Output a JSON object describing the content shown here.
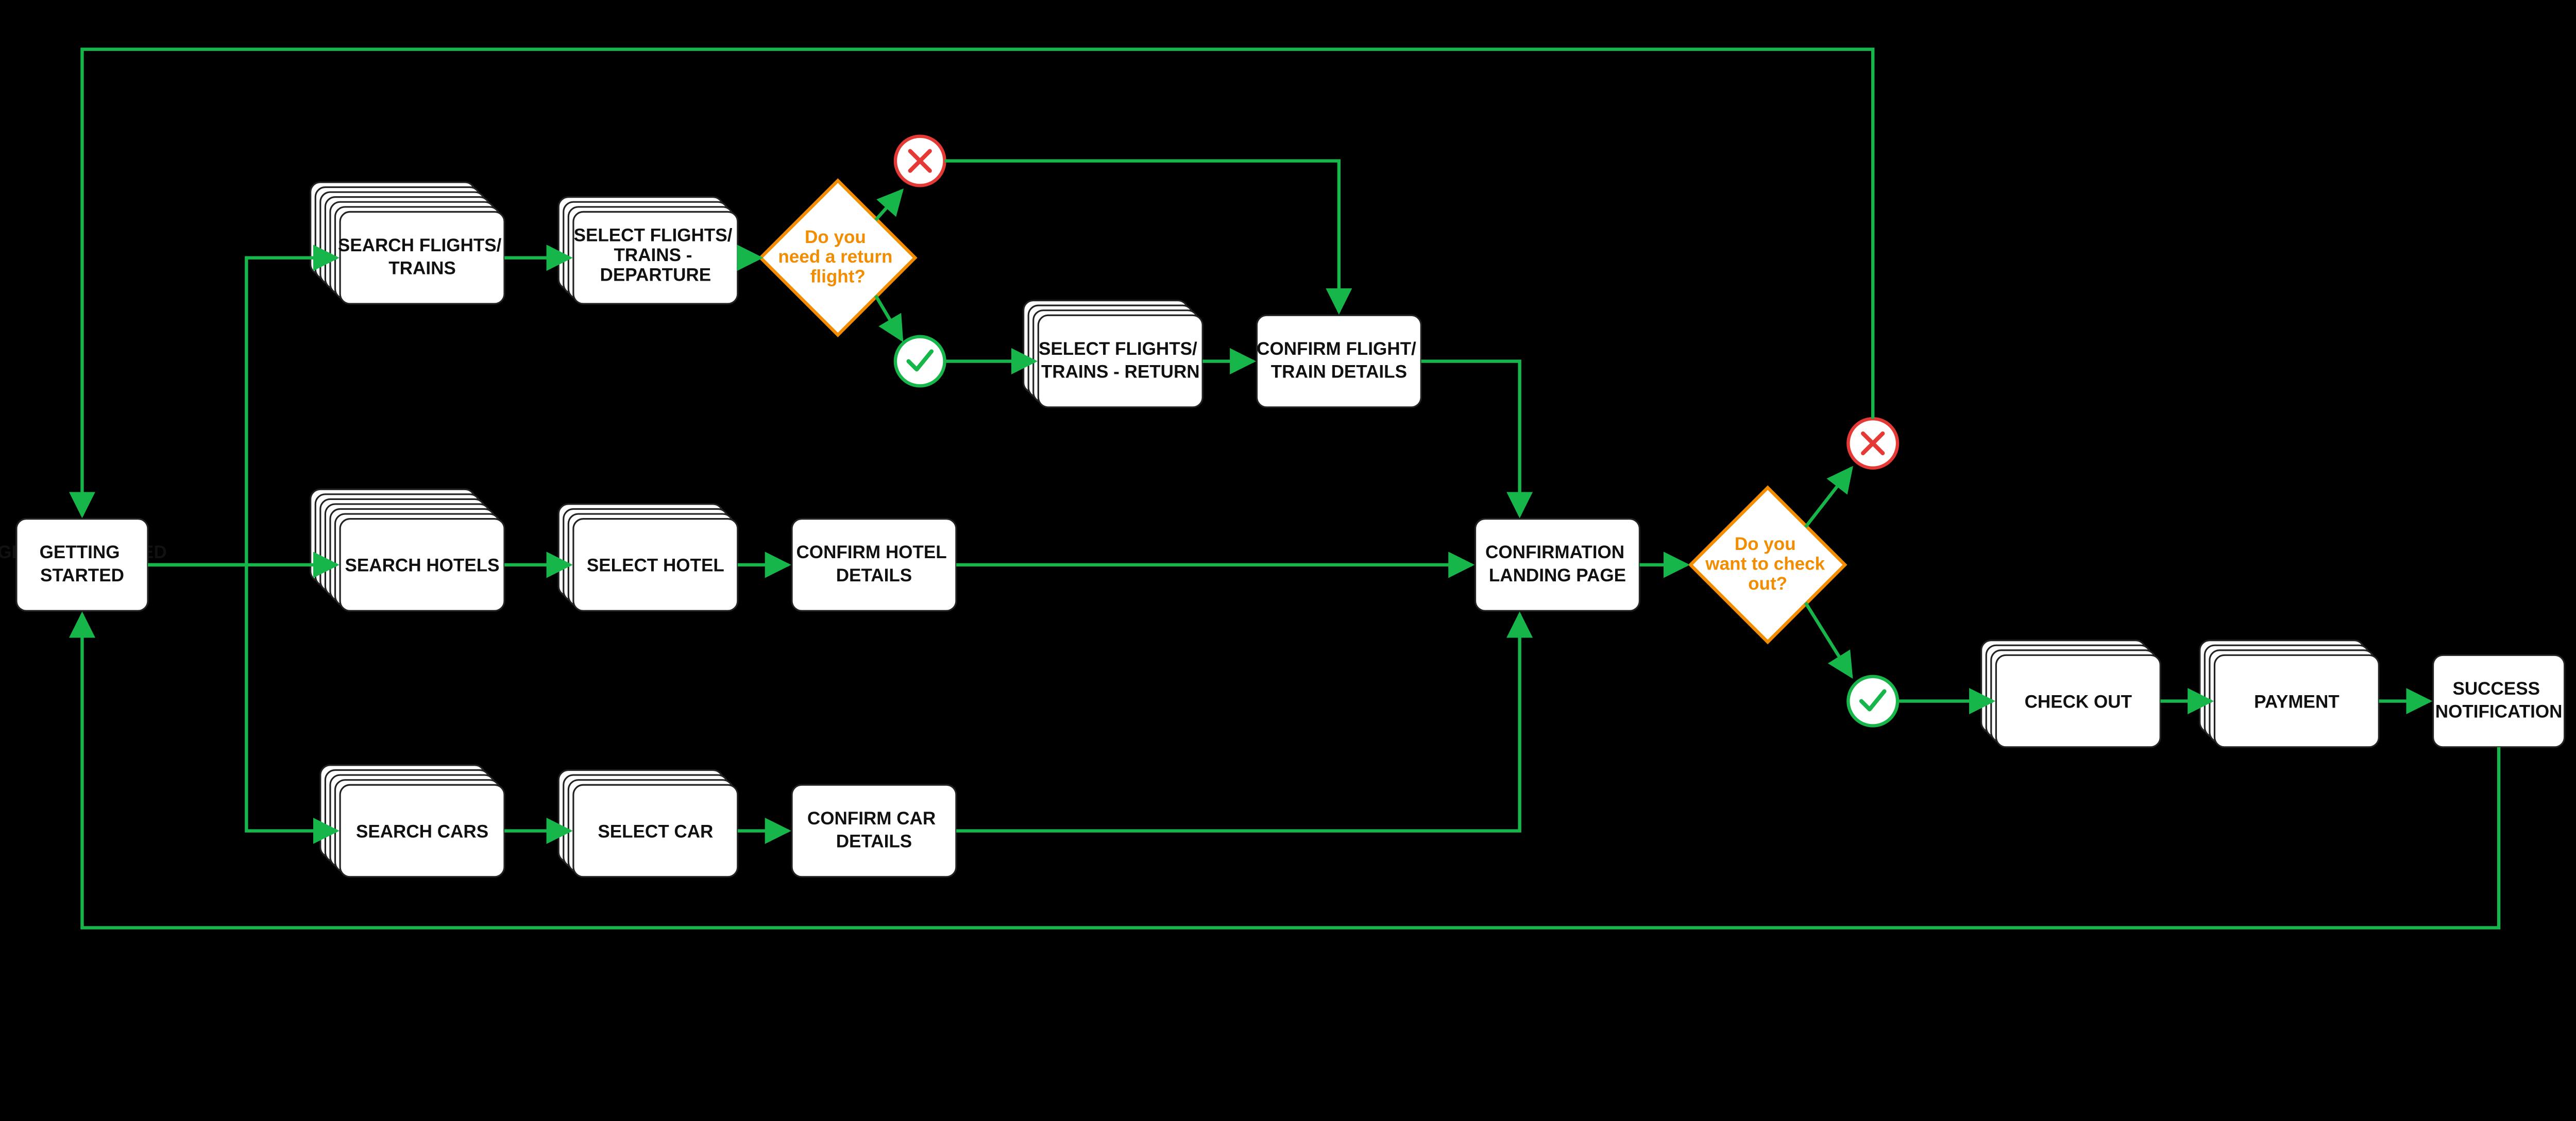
{
  "colors": {
    "background": "#000000",
    "node_fill": "#ffffff",
    "node_stroke": "#000000",
    "arrow": "#17b64a",
    "decision_stroke": "#f28c00",
    "decision_text": "#f28c00",
    "yes_stroke": "#17b64a",
    "no_stroke": "#e53935"
  },
  "nodes": {
    "getting_started": {
      "label": "GETTING STARTED"
    },
    "search_flights": {
      "label_l1": "SEARCH FLIGHTS/",
      "label_l2": "TRAINS"
    },
    "search_hotels": {
      "label": "SEARCH HOTELS"
    },
    "search_cars": {
      "label": "SEARCH CARS"
    },
    "select_flights_dep": {
      "label_l1": "SELECT FLIGHTS/",
      "label_l2": "TRAINS -",
      "label_l3": "DEPARTURE"
    },
    "select_hotel": {
      "label": "SELECT HOTEL"
    },
    "select_car": {
      "label": "SELECT CAR"
    },
    "select_flights_ret": {
      "label_l1": "SELECT FLIGHTS/",
      "label_l2": "TRAINS - RETURN"
    },
    "confirm_flight_details": {
      "label_l1": "CONFIRM FLIGHT/",
      "label_l2": "TRAIN DETAILS"
    },
    "confirm_hotel_details": {
      "label_l1": "CONFIRM HOTEL",
      "label_l2": "DETAILS"
    },
    "confirm_car_details": {
      "label_l1": "CONFIRM CAR",
      "label_l2": "DETAILS"
    },
    "confirmation_landing": {
      "label_l1": "CONFIRMATION",
      "label_l2": "LANDING PAGE"
    },
    "check_out": {
      "label": "CHECK OUT"
    },
    "payment": {
      "label": "PAYMENT"
    },
    "success": {
      "label_l1": "SUCCESS",
      "label_l2": "NOTIFICATION"
    }
  },
  "decisions": {
    "need_return": {
      "l1": "Do you",
      "l2": "need a return",
      "l3": "flight?"
    },
    "want_checkout": {
      "l1": "Do you",
      "l2": "want to check",
      "l3": "out?"
    }
  }
}
